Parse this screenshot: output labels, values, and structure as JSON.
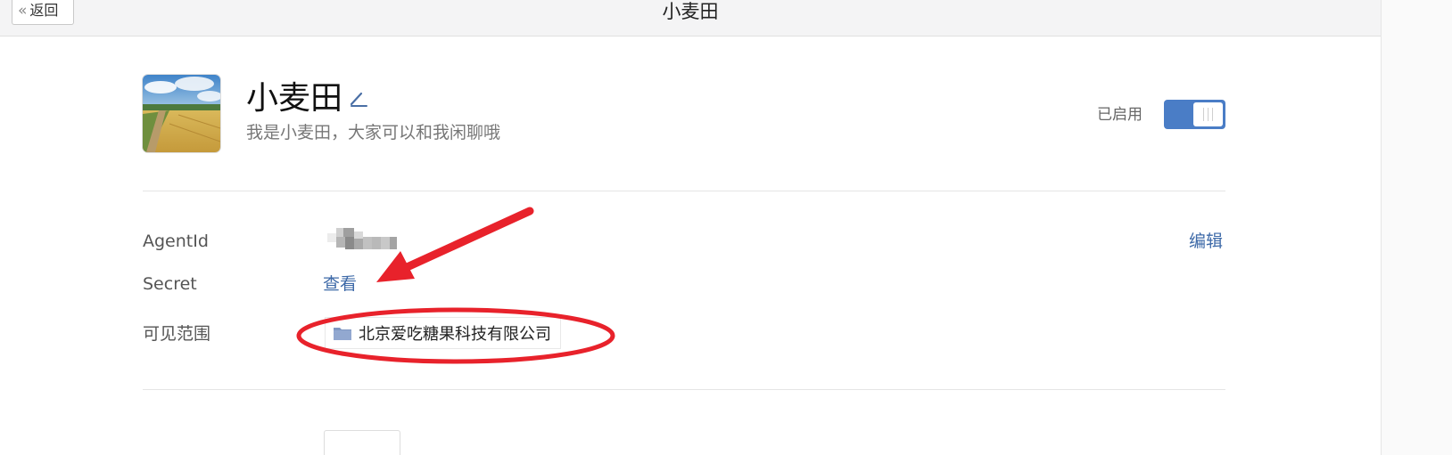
{
  "topbar": {
    "back_label": "返回",
    "title": "小麦田"
  },
  "app": {
    "name": "小麦田",
    "description": "我是小麦田，大家可以和我闲聊哦",
    "status_label": "已启用",
    "enabled": true,
    "toggle_color": "#4a7dc6"
  },
  "details": {
    "agentid_label": "AgentId",
    "secret_label": "Secret",
    "secret_action": "查看",
    "scope_label": "可见范围",
    "scope_value": "北京爱吃糖果科技有限公司",
    "edit_label": "编辑"
  },
  "annotations": {
    "color": "#e8222b"
  }
}
